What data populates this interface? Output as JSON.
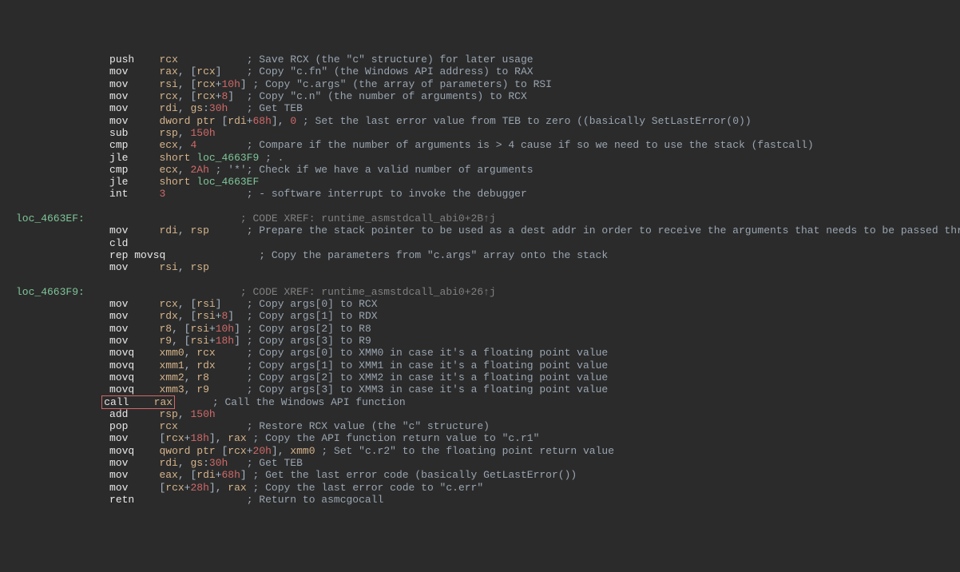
{
  "lines": [
    {
      "lbl": "",
      "m": "push",
      "op": [
        {
          "t": "reg",
          "v": "rcx"
        }
      ],
      "c": "; Save RCX (the \"c\" structure) for later usage"
    },
    {
      "lbl": "",
      "m": "mov",
      "op": [
        {
          "t": "reg",
          "v": "rax"
        },
        {
          "t": "p",
          "v": ", ["
        },
        {
          "t": "reg",
          "v": "rcx"
        },
        {
          "t": "p",
          "v": "]"
        }
      ],
      "c": "; Copy \"c.fn\" (the Windows API address) to RAX"
    },
    {
      "lbl": "",
      "m": "mov",
      "op": [
        {
          "t": "reg",
          "v": "rsi"
        },
        {
          "t": "p",
          "v": ", ["
        },
        {
          "t": "reg",
          "v": "rcx"
        },
        {
          "t": "p",
          "v": "+"
        },
        {
          "t": "num",
          "v": "10h"
        },
        {
          "t": "p",
          "v": "]"
        }
      ],
      "c": "; Copy \"c.args\" (the array of parameters) to RSI"
    },
    {
      "lbl": "",
      "m": "mov",
      "op": [
        {
          "t": "reg",
          "v": "rcx"
        },
        {
          "t": "p",
          "v": ", ["
        },
        {
          "t": "reg",
          "v": "rcx"
        },
        {
          "t": "p",
          "v": "+"
        },
        {
          "t": "num",
          "v": "8"
        },
        {
          "t": "p",
          "v": "]"
        }
      ],
      "c": "; Copy \"c.n\" (the number of arguments) to RCX"
    },
    {
      "lbl": "",
      "m": "mov",
      "op": [
        {
          "t": "reg",
          "v": "rdi"
        },
        {
          "t": "p",
          "v": ", "
        },
        {
          "t": "reg",
          "v": "gs"
        },
        {
          "t": "p",
          "v": ":"
        },
        {
          "t": "num",
          "v": "30h"
        }
      ],
      "c": "; Get TEB"
    },
    {
      "lbl": "",
      "m": "mov",
      "op": [
        {
          "t": "ptr",
          "v": "dword ptr "
        },
        {
          "t": "p",
          "v": "["
        },
        {
          "t": "reg",
          "v": "rdi"
        },
        {
          "t": "p",
          "v": "+"
        },
        {
          "t": "num",
          "v": "68h"
        },
        {
          "t": "p",
          "v": "], "
        },
        {
          "t": "num",
          "v": "0"
        }
      ],
      "c": " ; Set the last error value from TEB to zero ((basically SetLastError(0))",
      "wide": true
    },
    {
      "lbl": "",
      "m": "sub",
      "op": [
        {
          "t": "reg",
          "v": "rsp"
        },
        {
          "t": "p",
          "v": ", "
        },
        {
          "t": "num",
          "v": "150h"
        }
      ],
      "c": ""
    },
    {
      "lbl": "",
      "m": "cmp",
      "op": [
        {
          "t": "reg",
          "v": "ecx"
        },
        {
          "t": "p",
          "v": ", "
        },
        {
          "t": "num",
          "v": "4"
        }
      ],
      "c": "; Compare if the number of arguments is > 4 cause if so we need to use the stack (fastcall)"
    },
    {
      "lbl": "",
      "m": "jle",
      "op": [
        {
          "t": "ptr",
          "v": "short "
        },
        {
          "t": "lbl",
          "v": "loc_4663F9"
        }
      ],
      "c": " ; .",
      "wide": true
    },
    {
      "lbl": "",
      "m": "cmp",
      "op": [
        {
          "t": "reg",
          "v": "ecx"
        },
        {
          "t": "p",
          "v": ", "
        },
        {
          "t": "num",
          "v": "2Ah"
        },
        {
          "t": "cmt",
          "v": " ; '*'"
        }
      ],
      "c": "; Check if we have a valid number of arguments",
      "wide": true
    },
    {
      "lbl": "",
      "m": "jle",
      "op": [
        {
          "t": "ptr",
          "v": "short "
        },
        {
          "t": "lbl",
          "v": "loc_4663EF"
        }
      ],
      "c": ""
    },
    {
      "lbl": "",
      "m": "int",
      "op": [
        {
          "t": "num",
          "v": "3"
        }
      ],
      "c": "; - software interrupt to invoke the debugger"
    },
    {
      "blank": true
    },
    {
      "lbl": "loc_4663EF:",
      "m": "",
      "op": [],
      "c": "; CODE XREF: runtime_asmstdcall_abi0+2B↑j",
      "xref": true
    },
    {
      "lbl": "",
      "m": "mov",
      "op": [
        {
          "t": "reg",
          "v": "rdi"
        },
        {
          "t": "p",
          "v": ", "
        },
        {
          "t": "reg",
          "v": "rsp"
        }
      ],
      "c": "; Prepare the stack pointer to be used as a dest addr in order to receive the arguments that needs to be passed through the stack"
    },
    {
      "lbl": "",
      "m": "cld",
      "op": [],
      "c": ""
    },
    {
      "lbl": "",
      "m": "rep movsq",
      "op": [],
      "c": "; Copy the parameters from \"c.args\" array onto the stack"
    },
    {
      "lbl": "",
      "m": "mov",
      "op": [
        {
          "t": "reg",
          "v": "rsi"
        },
        {
          "t": "p",
          "v": ", "
        },
        {
          "t": "reg",
          "v": "rsp"
        }
      ],
      "c": ""
    },
    {
      "blank": true
    },
    {
      "lbl": "loc_4663F9:",
      "m": "",
      "op": [],
      "c": "; CODE XREF: runtime_asmstdcall_abi0+26↑j",
      "xref": true
    },
    {
      "lbl": "",
      "m": "mov",
      "op": [
        {
          "t": "reg",
          "v": "rcx"
        },
        {
          "t": "p",
          "v": ", ["
        },
        {
          "t": "reg",
          "v": "rsi"
        },
        {
          "t": "p",
          "v": "]"
        }
      ],
      "c": "; Copy args[0] to RCX"
    },
    {
      "lbl": "",
      "m": "mov",
      "op": [
        {
          "t": "reg",
          "v": "rdx"
        },
        {
          "t": "p",
          "v": ", ["
        },
        {
          "t": "reg",
          "v": "rsi"
        },
        {
          "t": "p",
          "v": "+"
        },
        {
          "t": "num",
          "v": "8"
        },
        {
          "t": "p",
          "v": "]"
        }
      ],
      "c": "; Copy args[1] to RDX"
    },
    {
      "lbl": "",
      "m": "mov",
      "op": [
        {
          "t": "reg",
          "v": "r8"
        },
        {
          "t": "p",
          "v": ", ["
        },
        {
          "t": "reg",
          "v": "rsi"
        },
        {
          "t": "p",
          "v": "+"
        },
        {
          "t": "num",
          "v": "10h"
        },
        {
          "t": "p",
          "v": "]"
        }
      ],
      "c": "; Copy args[2] to R8"
    },
    {
      "lbl": "",
      "m": "mov",
      "op": [
        {
          "t": "reg",
          "v": "r9"
        },
        {
          "t": "p",
          "v": ", ["
        },
        {
          "t": "reg",
          "v": "rsi"
        },
        {
          "t": "p",
          "v": "+"
        },
        {
          "t": "num",
          "v": "18h"
        },
        {
          "t": "p",
          "v": "]"
        }
      ],
      "c": "; Copy args[3] to R9"
    },
    {
      "lbl": "",
      "m": "movq",
      "op": [
        {
          "t": "reg",
          "v": "xmm0"
        },
        {
          "t": "p",
          "v": ", "
        },
        {
          "t": "reg",
          "v": "rcx"
        }
      ],
      "c": "; Copy args[0] to XMM0 in case it's a floating point value"
    },
    {
      "lbl": "",
      "m": "movq",
      "op": [
        {
          "t": "reg",
          "v": "xmm1"
        },
        {
          "t": "p",
          "v": ", "
        },
        {
          "t": "reg",
          "v": "rdx"
        }
      ],
      "c": "; Copy args[1] to XMM1 in case it's a floating point value"
    },
    {
      "lbl": "",
      "m": "movq",
      "op": [
        {
          "t": "reg",
          "v": "xmm2"
        },
        {
          "t": "p",
          "v": ", "
        },
        {
          "t": "reg",
          "v": "r8"
        }
      ],
      "c": "; Copy args[2] to XMM2 in case it's a floating point value"
    },
    {
      "lbl": "",
      "m": "movq",
      "op": [
        {
          "t": "reg",
          "v": "xmm3"
        },
        {
          "t": "p",
          "v": ", "
        },
        {
          "t": "reg",
          "v": "r9"
        }
      ],
      "c": "; Copy args[3] to XMM3 in case it's a floating point value"
    },
    {
      "lbl": "",
      "m": "call",
      "op": [
        {
          "t": "reg",
          "v": "rax"
        }
      ],
      "c": "; Call the Windows API function",
      "hl": true
    },
    {
      "lbl": "",
      "m": "add",
      "op": [
        {
          "t": "reg",
          "v": "rsp"
        },
        {
          "t": "p",
          "v": ", "
        },
        {
          "t": "num",
          "v": "150h"
        }
      ],
      "c": ""
    },
    {
      "lbl": "",
      "m": "pop",
      "op": [
        {
          "t": "reg",
          "v": "rcx"
        }
      ],
      "c": "; Restore RCX value (the \"c\" structure)"
    },
    {
      "lbl": "",
      "m": "mov",
      "op": [
        {
          "t": "p",
          "v": "["
        },
        {
          "t": "reg",
          "v": "rcx"
        },
        {
          "t": "p",
          "v": "+"
        },
        {
          "t": "num",
          "v": "18h"
        },
        {
          "t": "p",
          "v": "], "
        },
        {
          "t": "reg",
          "v": "rax"
        }
      ],
      "c": "; Copy the API function return value to \"c.r1\""
    },
    {
      "lbl": "",
      "m": "movq",
      "op": [
        {
          "t": "ptr",
          "v": "qword ptr "
        },
        {
          "t": "p",
          "v": "["
        },
        {
          "t": "reg",
          "v": "rcx"
        },
        {
          "t": "p",
          "v": "+"
        },
        {
          "t": "num",
          "v": "20h"
        },
        {
          "t": "p",
          "v": "], "
        },
        {
          "t": "reg",
          "v": "xmm0"
        }
      ],
      "c": " ; Set \"c.r2\" to the floating point return value",
      "wide": true
    },
    {
      "lbl": "",
      "m": "mov",
      "op": [
        {
          "t": "reg",
          "v": "rdi"
        },
        {
          "t": "p",
          "v": ", "
        },
        {
          "t": "reg",
          "v": "gs"
        },
        {
          "t": "p",
          "v": ":"
        },
        {
          "t": "num",
          "v": "30h"
        }
      ],
      "c": "; Get TEB"
    },
    {
      "lbl": "",
      "m": "mov",
      "op": [
        {
          "t": "reg",
          "v": "eax"
        },
        {
          "t": "p",
          "v": ", ["
        },
        {
          "t": "reg",
          "v": "rdi"
        },
        {
          "t": "p",
          "v": "+"
        },
        {
          "t": "num",
          "v": "68h"
        },
        {
          "t": "p",
          "v": "]"
        }
      ],
      "c": "; Get the last error code (basically GetLastError())"
    },
    {
      "lbl": "",
      "m": "mov",
      "op": [
        {
          "t": "p",
          "v": "["
        },
        {
          "t": "reg",
          "v": "rcx"
        },
        {
          "t": "p",
          "v": "+"
        },
        {
          "t": "num",
          "v": "28h"
        },
        {
          "t": "p",
          "v": "], "
        },
        {
          "t": "reg",
          "v": "rax"
        }
      ],
      "c": "; Copy the last error code to \"c.err\""
    },
    {
      "lbl": "",
      "m": "retn",
      "op": [],
      "c": "; Return to asmcgocall"
    }
  ]
}
